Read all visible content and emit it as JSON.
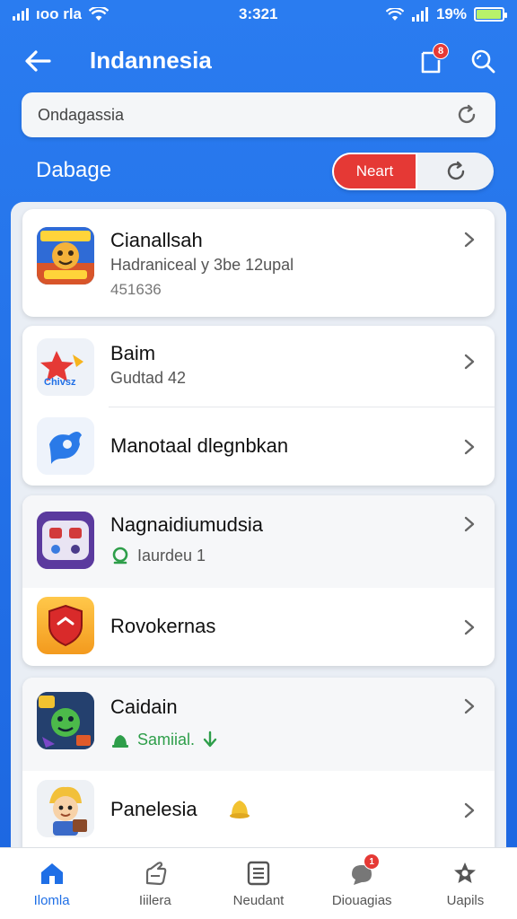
{
  "status_bar": {
    "carrier": "ıoo rla",
    "time": "3:321",
    "battery_percent": "19%",
    "battery_level": 0.95
  },
  "header": {
    "title": "Indannesia",
    "notif_badge": "8"
  },
  "search": {
    "value": "Ondagassia"
  },
  "section": {
    "label": "Dabage",
    "segment_active": "Neart"
  },
  "cards": [
    {
      "rows": [
        {
          "title": "Cianallsah",
          "subtitle": "Hadraniceal y 3be 12upal",
          "detail": "451636",
          "icon": "game-cartoon-icon"
        }
      ]
    },
    {
      "rows": [
        {
          "title": "Baim",
          "subtitle": "Gudtad 42",
          "icon": "star-logo-icon"
        },
        {
          "title": "Manotaal dlegnbkan",
          "icon": "blue-bird-icon"
        }
      ]
    },
    {
      "rows": [
        {
          "title": "Nagnaidiumudsia",
          "status_text": "Iaurdeu 1",
          "status_color": "#2e9e4a",
          "icon": "purple-controller-icon"
        },
        {
          "title": "Rovokernas",
          "icon": "red-shield-icon"
        }
      ]
    },
    {
      "rows": [
        {
          "title": "Caidain",
          "status_text": "Samiial.",
          "status_color": "#2e9e4a",
          "icon": "green-creature-icon"
        },
        {
          "title": "Panelesia",
          "icon": "cartoon-boy-icon"
        }
      ]
    }
  ],
  "bottom_nav": [
    {
      "label": "Ilomla",
      "icon": "home-icon",
      "active": true
    },
    {
      "label": "Iiilera",
      "icon": "hand-icon",
      "active": false
    },
    {
      "label": "Neudant",
      "icon": "document-icon",
      "active": false
    },
    {
      "label": "Diouagias",
      "icon": "chat-icon",
      "active": false,
      "badge": "1"
    },
    {
      "label": "Uapils",
      "icon": "settings-star-icon",
      "active": false
    }
  ],
  "colors": {
    "primary": "#1f6fe6",
    "danger": "#e53935",
    "success": "#2e9e4a"
  }
}
